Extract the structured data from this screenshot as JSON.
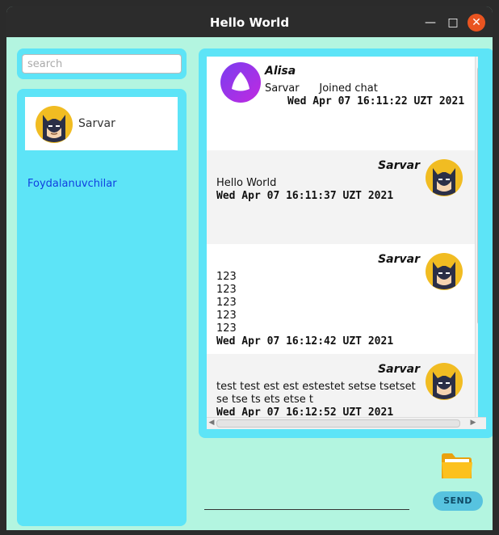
{
  "window": {
    "title": "Hello World",
    "minimize_label": "—",
    "maximize_label": "□",
    "close_label": "✕"
  },
  "search": {
    "placeholder": "search",
    "value": ""
  },
  "users": {
    "items": [
      {
        "name": "Sarvar",
        "avatar": "batman-avatar"
      }
    ],
    "link_label": "Foydalanuvchilar"
  },
  "messages": [
    {
      "sender": "Alisa",
      "lines": [
        "Sarvar      Joined chat"
      ],
      "date": "Wed Apr 07 16:11:22 UZT 2021",
      "avatar": "alisa-logo",
      "side": "left"
    },
    {
      "sender": "Sarvar",
      "lines": [
        "Hello World"
      ],
      "date": "Wed Apr 07 16:11:37 UZT 2021",
      "avatar": "batman-avatar",
      "side": "right"
    },
    {
      "sender": "Sarvar",
      "lines": [
        "123",
        "123",
        "123",
        "123",
        "123"
      ],
      "date": "Wed Apr 07 16:12:42 UZT 2021",
      "avatar": "batman-avatar",
      "side": "right"
    },
    {
      "sender": "Sarvar",
      "lines": [
        "test test est est estestet setse tsetset",
        "se tse ts ets etse t"
      ],
      "date": "Wed Apr 07 16:12:52 UZT 2021",
      "avatar": "batman-avatar",
      "side": "right"
    }
  ],
  "composer": {
    "attach_icon": "folder-icon",
    "send_label": "SEND",
    "value": ""
  },
  "colors": {
    "background": "#b3f5e0",
    "panel": "#5de4f7",
    "send_button": "#57c3df",
    "link": "#1040e0",
    "close": "#e95420"
  }
}
